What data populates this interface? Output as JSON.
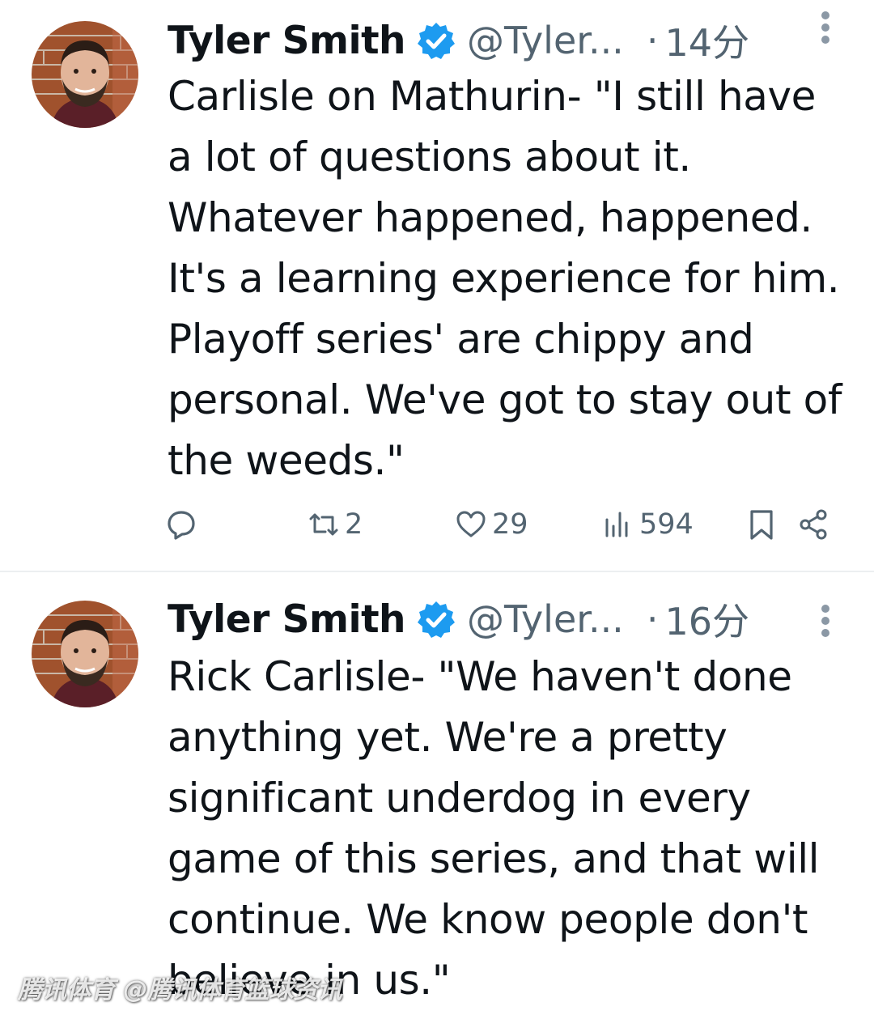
{
  "tweets": [
    {
      "author": "Tyler Smith",
      "handle": "@Tyler...",
      "time": "14分",
      "text": "Carlisle on Mathurin- \"I still have\na lot of questions about it.\nWhatever happened, happened.\nIt's a learning experience for him.\nPlayoff series' are chippy and\npersonal. We've got to stay out of\nthe weeds.\"",
      "retweets": "2",
      "likes": "29",
      "views": "594"
    },
    {
      "author": "Tyler Smith",
      "handle": "@Tyler...",
      "time": "16分",
      "text": "Rick Carlisle- \"We haven't done\nanything yet. We're a pretty\nsignificant underdog in every\ngame of this series, and that will\ncontinue. We know people don't\nbelieve in us.\""
    }
  ],
  "watermark": "腾讯体育 @腾讯体育篮球资讯",
  "colors": {
    "text": "#0f1419",
    "muted": "#536471",
    "verified": "#1d9bf0",
    "divider": "#eceff1"
  },
  "icons": [
    "verified-badge-icon",
    "more-options-icon",
    "reply-icon",
    "retweet-icon",
    "like-icon",
    "views-icon",
    "bookmark-icon",
    "share-icon"
  ]
}
